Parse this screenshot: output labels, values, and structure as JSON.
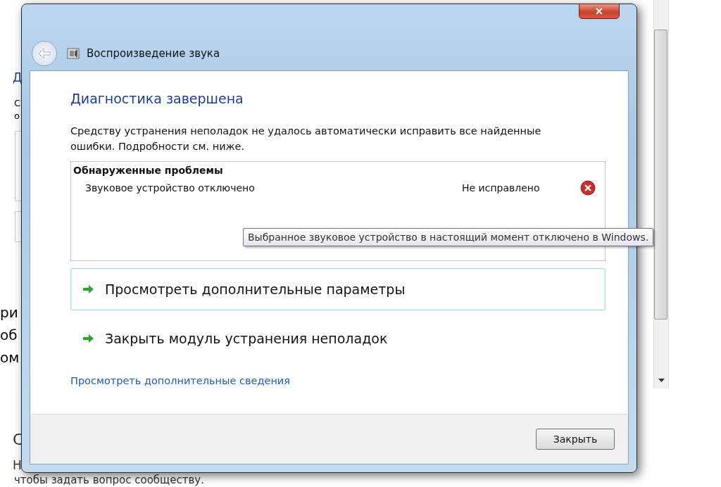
{
  "background": {
    "fragments": [
      {
        "text": "Д",
        "kind": "heading"
      },
      {
        "text": "С",
        "kind": "text"
      },
      {
        "text": "о",
        "kind": "text"
      }
    ],
    "lower_fragments": [
      "ри",
      "об",
      "ом"
    ],
    "section_letter": "С",
    "line_letter": "Н",
    "bottom_text": "чтобы задать вопрос сообществу."
  },
  "window": {
    "title": "Воспроизведение звука",
    "close": "✕"
  },
  "heading": "Диагностика завершена",
  "message": "Средству устранения неполадок не удалось автоматически исправить все найденные ошибки. Подробности см. ниже.",
  "problems": {
    "title": "Обнаруженные проблемы",
    "rows": [
      {
        "name": "Звуковое устройство отключено",
        "status": "Не исправлено",
        "fixed": false
      }
    ]
  },
  "tooltip": "Выбранное звуковое устройство в настоящий момент отключено в Windows.",
  "commands": [
    {
      "label": "Просмотреть дополнительные параметры",
      "selected": true
    },
    {
      "label": "Закрыть модуль устранения неполадок",
      "selected": false
    }
  ],
  "details_link": "Просмотреть дополнительные сведения",
  "buttons": [
    "Закрыть"
  ]
}
